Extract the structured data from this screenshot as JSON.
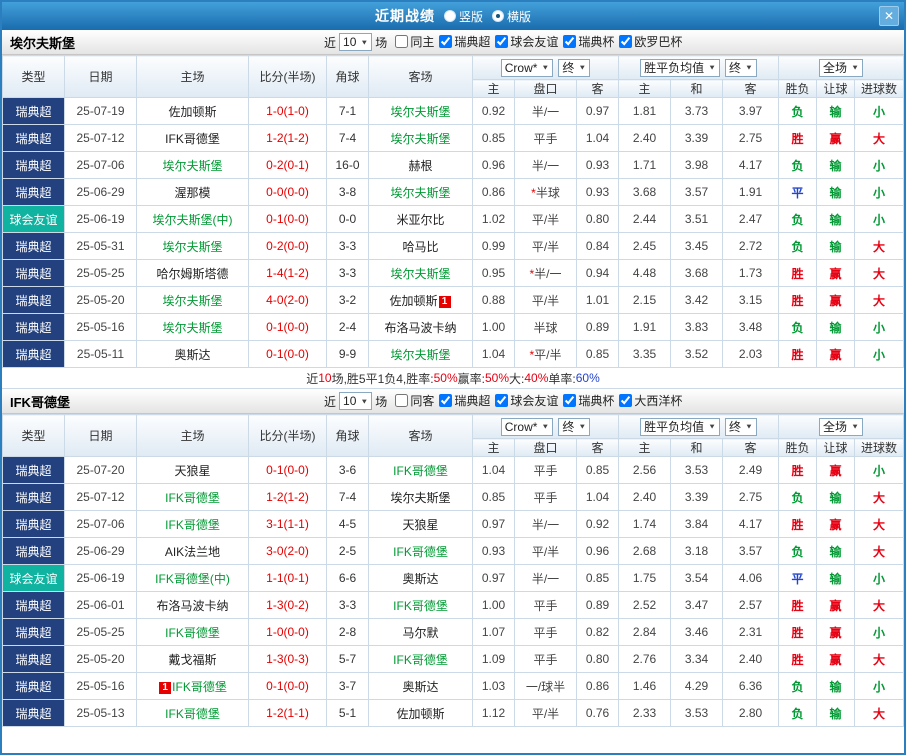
{
  "topbar": {
    "title": "近期战绩",
    "layout_options": [
      {
        "label": "竖版",
        "selected": false
      },
      {
        "label": "横版",
        "selected": true
      }
    ],
    "close_icon": "✕"
  },
  "labels": {
    "near": "近",
    "games": "场"
  },
  "columns": {
    "type": "类型",
    "date": "日期",
    "home": "主场",
    "score": "比分(半场)",
    "corner": "角球",
    "away": "客场",
    "bookmaker": "Crow*",
    "final": "终",
    "ah_home": "主",
    "ah_line": "盘口",
    "ah_away": "客",
    "europe_avg": "胜平负均值",
    "eu_home": "主",
    "eu_draw": "和",
    "eu_away": "客",
    "scope": "全场",
    "res_wdl": "胜负",
    "res_let": "让球",
    "res_goals": "进球数"
  },
  "result_class_map": {
    "胜": "red",
    "赢": "red",
    "大": "red",
    "负": "green",
    "输": "green",
    "小": "green",
    "平": "blue"
  },
  "colors": {
    "accent_blue": "#1a6cad",
    "league_bg": "#24417f",
    "friendly_bg": "#0fb3a0",
    "focal_team": "#009933",
    "win_red": "#e60012",
    "lose_green": "#009933",
    "draw_blue": "#2244cc",
    "score_red": "#e60000"
  },
  "sections": [
    {
      "team": "埃尔夫斯堡",
      "filter": {
        "count": "10",
        "checkboxes": [
          {
            "label": "同主",
            "checked": false
          },
          {
            "label": "瑞典超",
            "checked": true
          },
          {
            "label": "球会友谊",
            "checked": true
          },
          {
            "label": "瑞典杯",
            "checked": true
          },
          {
            "label": "欧罗巴杯",
            "checked": true
          }
        ]
      },
      "rows": [
        {
          "type": "瑞典超",
          "type_cls": "league",
          "date": "25-07-19",
          "home": "佐加顿斯",
          "home_focal": false,
          "home_badge": "",
          "score": "1-0(1-0)",
          "corner": "7-1",
          "away": "埃尔夫斯堡",
          "away_focal": true,
          "away_badge": "",
          "ah_home": "0.92",
          "ah_line": "半/一",
          "ah_away": "0.97",
          "eu_home": "1.81",
          "eu_draw": "3.73",
          "eu_away": "3.97",
          "res_wdl": "负",
          "res_let": "输",
          "res_goals": "小"
        },
        {
          "type": "瑞典超",
          "type_cls": "league",
          "date": "25-07-12",
          "home": "IFK哥德堡",
          "home_focal": false,
          "home_badge": "",
          "score": "1-2(1-2)",
          "corner": "7-4",
          "away": "埃尔夫斯堡",
          "away_focal": true,
          "away_badge": "",
          "ah_home": "0.85",
          "ah_line": "平手",
          "ah_away": "1.04",
          "eu_home": "2.40",
          "eu_draw": "3.39",
          "eu_away": "2.75",
          "res_wdl": "胜",
          "res_let": "赢",
          "res_goals": "大"
        },
        {
          "type": "瑞典超",
          "type_cls": "league",
          "date": "25-07-06",
          "home": "埃尔夫斯堡",
          "home_focal": true,
          "home_badge": "",
          "score": "0-2(0-1)",
          "corner": "16-0",
          "away": "赫根",
          "away_focal": false,
          "away_badge": "",
          "ah_home": "0.96",
          "ah_line": "半/一",
          "ah_away": "0.93",
          "eu_home": "1.71",
          "eu_draw": "3.98",
          "eu_away": "4.17",
          "res_wdl": "负",
          "res_let": "输",
          "res_goals": "小"
        },
        {
          "type": "瑞典超",
          "type_cls": "league",
          "date": "25-06-29",
          "home": "渥那模",
          "home_focal": false,
          "home_badge": "",
          "score": "0-0(0-0)",
          "corner": "3-8",
          "away": "埃尔夫斯堡",
          "away_focal": true,
          "away_badge": "",
          "ah_home": "0.86",
          "ah_line": "*半球",
          "ah_away": "0.93",
          "eu_home": "3.68",
          "eu_draw": "3.57",
          "eu_away": "1.91",
          "res_wdl": "平",
          "res_let": "输",
          "res_goals": "小"
        },
        {
          "type": "球会友谊",
          "type_cls": "friendly",
          "date": "25-06-19",
          "home": "埃尔夫斯堡(中)",
          "home_focal": true,
          "home_badge": "",
          "score": "0-1(0-0)",
          "corner": "0-0",
          "away": "米亚尔比",
          "away_focal": false,
          "away_badge": "",
          "ah_home": "1.02",
          "ah_line": "平/半",
          "ah_away": "0.80",
          "eu_home": "2.44",
          "eu_draw": "3.51",
          "eu_away": "2.47",
          "res_wdl": "负",
          "res_let": "输",
          "res_goals": "小"
        },
        {
          "type": "瑞典超",
          "type_cls": "league",
          "date": "25-05-31",
          "home": "埃尔夫斯堡",
          "home_focal": true,
          "home_badge": "",
          "score": "0-2(0-0)",
          "corner": "3-3",
          "away": "哈马比",
          "away_focal": false,
          "away_badge": "",
          "ah_home": "0.99",
          "ah_line": "平/半",
          "ah_away": "0.84",
          "eu_home": "2.45",
          "eu_draw": "3.45",
          "eu_away": "2.72",
          "res_wdl": "负",
          "res_let": "输",
          "res_goals": "大"
        },
        {
          "type": "瑞典超",
          "type_cls": "league",
          "date": "25-05-25",
          "home": "哈尔姆斯塔德",
          "home_focal": false,
          "home_badge": "",
          "score": "1-4(1-2)",
          "corner": "3-3",
          "away": "埃尔夫斯堡",
          "away_focal": true,
          "away_badge": "",
          "ah_home": "0.95",
          "ah_line": "*半/一",
          "ah_away": "0.94",
          "eu_home": "4.48",
          "eu_draw": "3.68",
          "eu_away": "1.73",
          "res_wdl": "胜",
          "res_let": "赢",
          "res_goals": "大"
        },
        {
          "type": "瑞典超",
          "type_cls": "league",
          "date": "25-05-20",
          "home": "埃尔夫斯堡",
          "home_focal": true,
          "home_badge": "",
          "score": "4-0(2-0)",
          "corner": "3-2",
          "away": "佐加顿斯",
          "away_focal": false,
          "away_badge": "1",
          "ah_home": "0.88",
          "ah_line": "平/半",
          "ah_away": "1.01",
          "eu_home": "2.15",
          "eu_draw": "3.42",
          "eu_away": "3.15",
          "res_wdl": "胜",
          "res_let": "赢",
          "res_goals": "大"
        },
        {
          "type": "瑞典超",
          "type_cls": "league",
          "date": "25-05-16",
          "home": "埃尔夫斯堡",
          "home_focal": true,
          "home_badge": "",
          "score": "0-1(0-0)",
          "corner": "2-4",
          "away": "布洛马波卡纳",
          "away_focal": false,
          "away_badge": "",
          "ah_home": "1.00",
          "ah_line": "半球",
          "ah_away": "0.89",
          "eu_home": "1.91",
          "eu_draw": "3.83",
          "eu_away": "3.48",
          "res_wdl": "负",
          "res_let": "输",
          "res_goals": "小"
        },
        {
          "type": "瑞典超",
          "type_cls": "league",
          "date": "25-05-11",
          "home": "奥斯达",
          "home_focal": false,
          "home_badge": "",
          "score": "0-1(0-0)",
          "corner": "9-9",
          "away": "埃尔夫斯堡",
          "away_focal": true,
          "away_badge": "",
          "ah_home": "1.04",
          "ah_line": "*平/半",
          "ah_away": "0.85",
          "eu_home": "3.35",
          "eu_draw": "3.52",
          "eu_away": "2.03",
          "res_wdl": "胜",
          "res_let": "赢",
          "res_goals": "小"
        }
      ],
      "summary": [
        {
          "t": "近",
          "c": "text"
        },
        {
          "t": "10",
          "c": "red"
        },
        {
          "t": "场,胜5平1负4, ",
          "c": "text"
        },
        {
          "t": "胜率:",
          "c": "text"
        },
        {
          "t": "50%",
          "c": "red"
        },
        {
          "t": " 赢率:",
          "c": "text"
        },
        {
          "t": "50%",
          "c": "red"
        },
        {
          "t": " 大:",
          "c": "text"
        },
        {
          "t": "40%",
          "c": "red"
        },
        {
          "t": " 单率:",
          "c": "text"
        },
        {
          "t": "60%",
          "c": "blue"
        }
      ]
    },
    {
      "team": "IFK哥德堡",
      "filter": {
        "count": "10",
        "checkboxes": [
          {
            "label": "同客",
            "checked": false
          },
          {
            "label": "瑞典超",
            "checked": true
          },
          {
            "label": "球会友谊",
            "checked": true
          },
          {
            "label": "瑞典杯",
            "checked": true
          },
          {
            "label": "大西洋杯",
            "checked": true
          }
        ]
      },
      "rows": [
        {
          "type": "瑞典超",
          "type_cls": "league",
          "date": "25-07-20",
          "home": "天狼星",
          "home_focal": false,
          "home_badge": "",
          "score": "0-1(0-0)",
          "corner": "3-6",
          "away": "IFK哥德堡",
          "away_focal": true,
          "away_badge": "",
          "ah_home": "1.04",
          "ah_line": "平手",
          "ah_away": "0.85",
          "eu_home": "2.56",
          "eu_draw": "3.53",
          "eu_away": "2.49",
          "res_wdl": "胜",
          "res_let": "赢",
          "res_goals": "小"
        },
        {
          "type": "瑞典超",
          "type_cls": "league",
          "date": "25-07-12",
          "home": "IFK哥德堡",
          "home_focal": true,
          "home_badge": "",
          "score": "1-2(1-2)",
          "corner": "7-4",
          "away": "埃尔夫斯堡",
          "away_focal": false,
          "away_badge": "",
          "ah_home": "0.85",
          "ah_line": "平手",
          "ah_away": "1.04",
          "eu_home": "2.40",
          "eu_draw": "3.39",
          "eu_away": "2.75",
          "res_wdl": "负",
          "res_let": "输",
          "res_goals": "大"
        },
        {
          "type": "瑞典超",
          "type_cls": "league",
          "date": "25-07-06",
          "home": "IFK哥德堡",
          "home_focal": true,
          "home_badge": "",
          "score": "3-1(1-1)",
          "corner": "4-5",
          "away": "天狼星",
          "away_focal": false,
          "away_badge": "",
          "ah_home": "0.97",
          "ah_line": "半/一",
          "ah_away": "0.92",
          "eu_home": "1.74",
          "eu_draw": "3.84",
          "eu_away": "4.17",
          "res_wdl": "胜",
          "res_let": "赢",
          "res_goals": "大"
        },
        {
          "type": "瑞典超",
          "type_cls": "league",
          "date": "25-06-29",
          "home": "AIK法兰地",
          "home_focal": false,
          "home_badge": "",
          "score": "3-0(2-0)",
          "corner": "2-5",
          "away": "IFK哥德堡",
          "away_focal": true,
          "away_badge": "",
          "ah_home": "0.93",
          "ah_line": "平/半",
          "ah_away": "0.96",
          "eu_home": "2.68",
          "eu_draw": "3.18",
          "eu_away": "3.57",
          "res_wdl": "负",
          "res_let": "输",
          "res_goals": "大"
        },
        {
          "type": "球会友谊",
          "type_cls": "friendly",
          "date": "25-06-19",
          "home": "IFK哥德堡(中)",
          "home_focal": true,
          "home_badge": "",
          "score": "1-1(0-1)",
          "corner": "6-6",
          "away": "奥斯达",
          "away_focal": false,
          "away_badge": "",
          "ah_home": "0.97",
          "ah_line": "半/一",
          "ah_away": "0.85",
          "eu_home": "1.75",
          "eu_draw": "3.54",
          "eu_away": "4.06",
          "res_wdl": "平",
          "res_let": "输",
          "res_goals": "小"
        },
        {
          "type": "瑞典超",
          "type_cls": "league",
          "date": "25-06-01",
          "home": "布洛马波卡纳",
          "home_focal": false,
          "home_badge": "",
          "score": "1-3(0-2)",
          "corner": "3-3",
          "away": "IFK哥德堡",
          "away_focal": true,
          "away_badge": "",
          "ah_home": "1.00",
          "ah_line": "平手",
          "ah_away": "0.89",
          "eu_home": "2.52",
          "eu_draw": "3.47",
          "eu_away": "2.57",
          "res_wdl": "胜",
          "res_let": "赢",
          "res_goals": "大"
        },
        {
          "type": "瑞典超",
          "type_cls": "league",
          "date": "25-05-25",
          "home": "IFK哥德堡",
          "home_focal": true,
          "home_badge": "",
          "score": "1-0(0-0)",
          "corner": "2-8",
          "away": "马尔默",
          "away_focal": false,
          "away_badge": "",
          "ah_home": "1.07",
          "ah_line": "平手",
          "ah_away": "0.82",
          "eu_home": "2.84",
          "eu_draw": "3.46",
          "eu_away": "2.31",
          "res_wdl": "胜",
          "res_let": "赢",
          "res_goals": "小"
        },
        {
          "type": "瑞典超",
          "type_cls": "league",
          "date": "25-05-20",
          "home": "戴戈福斯",
          "home_focal": false,
          "home_badge": "",
          "score": "1-3(0-3)",
          "corner": "5-7",
          "away": "IFK哥德堡",
          "away_focal": true,
          "away_badge": "",
          "ah_home": "1.09",
          "ah_line": "平手",
          "ah_away": "0.80",
          "eu_home": "2.76",
          "eu_draw": "3.34",
          "eu_away": "2.40",
          "res_wdl": "胜",
          "res_let": "赢",
          "res_goals": "大"
        },
        {
          "type": "瑞典超",
          "type_cls": "league",
          "date": "25-05-16",
          "home": "IFK哥德堡",
          "home_focal": true,
          "home_badge": "1",
          "score": "0-1(0-0)",
          "corner": "3-7",
          "away": "奥斯达",
          "away_focal": false,
          "away_badge": "",
          "ah_home": "1.03",
          "ah_line": "一/球半",
          "ah_away": "0.86",
          "eu_home": "1.46",
          "eu_draw": "4.29",
          "eu_away": "6.36",
          "res_wdl": "负",
          "res_let": "输",
          "res_goals": "小"
        },
        {
          "type": "瑞典超",
          "type_cls": "league",
          "date": "25-05-13",
          "home": "IFK哥德堡",
          "home_focal": true,
          "home_badge": "",
          "score": "1-2(1-1)",
          "corner": "5-1",
          "away": "佐加顿斯",
          "away_focal": false,
          "away_badge": "",
          "ah_home": "1.12",
          "ah_line": "平/半",
          "ah_away": "0.76",
          "eu_home": "2.33",
          "eu_draw": "3.53",
          "eu_away": "2.80",
          "res_wdl": "负",
          "res_let": "输",
          "res_goals": "大"
        }
      ],
      "summary": []
    }
  ]
}
